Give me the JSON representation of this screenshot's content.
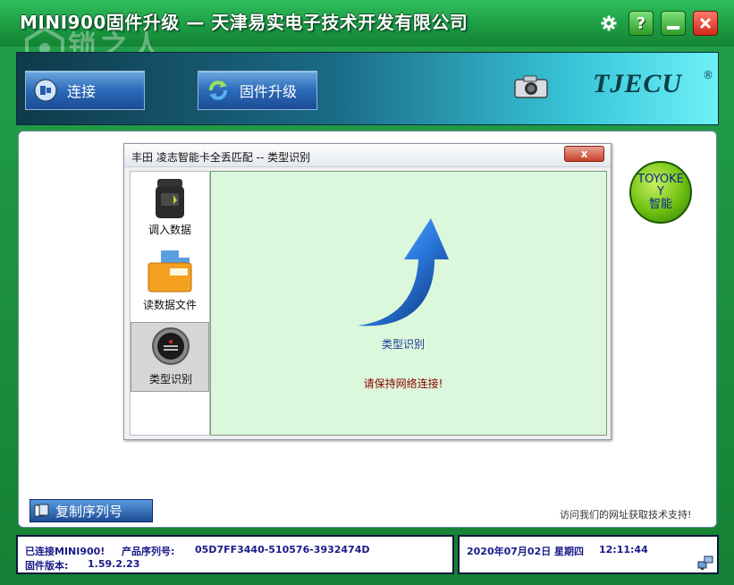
{
  "window": {
    "title": "MINI900固件升级 — 天津易实电子技术开发有限公司",
    "watermark_cn": "锁之人",
    "watermark_en": "SUOYIREN.COM",
    "titlebar_help": "?"
  },
  "toolbar": {
    "connect_label": "连接",
    "upgrade_label": "固件升级",
    "brand": "TJECU",
    "brand_reg": "®"
  },
  "dialog": {
    "title": "丰田 凌志智能卡全丢匹配 -- 类型识别",
    "close_label": "x",
    "side_items": [
      {
        "label": "调入数据"
      },
      {
        "label": "读数据文件"
      },
      {
        "label": "类型识别",
        "active": true
      }
    ],
    "content_label": "类型识别",
    "warning": "请保持网络连接!"
  },
  "badge": {
    "line1": "TOYOKE",
    "line2": "Y",
    "line3": "智能"
  },
  "copy_button": {
    "label": "复制序列号"
  },
  "visit_text": "访问我们的网址获取技术支持!",
  "status": {
    "connected": "已连接MINI900!",
    "serial_label": "产品序列号:",
    "serial_value": "05D7FF3440-510576-3932474D",
    "firmware_label": "固件版本:",
    "firmware_value": "1.59.2.23",
    "date": "2020年07月02日",
    "weekday": "星期四",
    "time": "12:11:44"
  },
  "colors": {
    "titlebar": "#1b9a42",
    "content_bg": "#dcf8dc",
    "warning": "#8a0000",
    "status_text": "#1a1a8a"
  }
}
